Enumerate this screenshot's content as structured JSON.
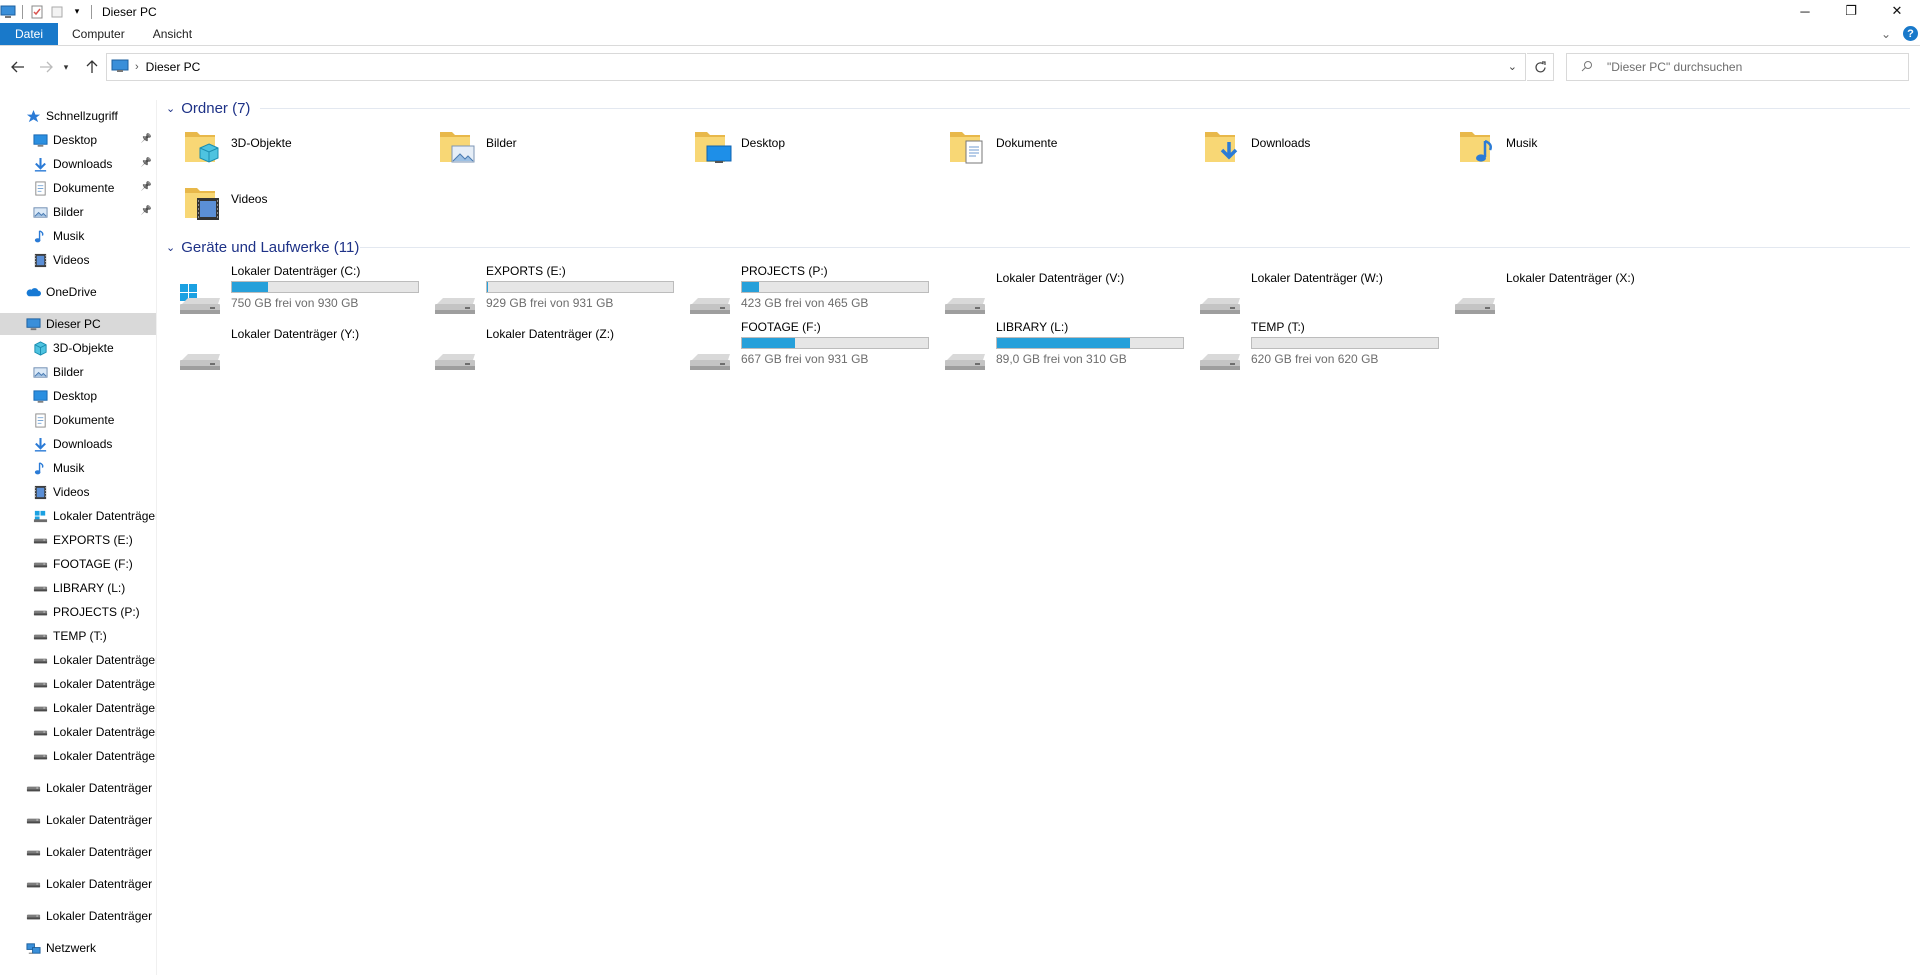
{
  "window": {
    "title": "Dieser PC",
    "controls": {
      "minimize": "─",
      "maximize": "❐",
      "close": "✕"
    }
  },
  "ribbon": {
    "tabs": [
      "Datei",
      "Computer",
      "Ansicht"
    ],
    "help_label": "?"
  },
  "address": {
    "crumbs": [
      "Dieser PC"
    ],
    "search_placeholder": "\"Dieser PC\" durchsuchen"
  },
  "sidebar": {
    "quick_access": "Schnellzugriff",
    "quick_items": [
      {
        "label": "Desktop",
        "icon": "desktop-icon",
        "pinned": true
      },
      {
        "label": "Downloads",
        "icon": "downloads-icon",
        "pinned": true
      },
      {
        "label": "Dokumente",
        "icon": "documents-icon",
        "pinned": true
      },
      {
        "label": "Bilder",
        "icon": "pictures-icon",
        "pinned": true
      },
      {
        "label": "Musik",
        "icon": "music-icon",
        "pinned": false
      },
      {
        "label": "Videos",
        "icon": "videos-icon",
        "pinned": false
      }
    ],
    "onedrive": "OneDrive",
    "this_pc": "Dieser PC",
    "pc_items": [
      {
        "label": "3D-Objekte",
        "icon": "3d-objects-icon"
      },
      {
        "label": "Bilder",
        "icon": "pictures-icon"
      },
      {
        "label": "Desktop",
        "icon": "desktop-icon"
      },
      {
        "label": "Dokumente",
        "icon": "documents-icon"
      },
      {
        "label": "Downloads",
        "icon": "downloads-icon"
      },
      {
        "label": "Musik",
        "icon": "music-icon"
      },
      {
        "label": "Videos",
        "icon": "videos-icon"
      },
      {
        "label": "Lokaler Datenträger",
        "icon": "windows-drive-icon"
      },
      {
        "label": "EXPORTS (E:)",
        "icon": "drive-icon"
      },
      {
        "label": "FOOTAGE (F:)",
        "icon": "drive-icon"
      },
      {
        "label": "LIBRARY (L:)",
        "icon": "drive-icon"
      },
      {
        "label": "PROJECTS (P:)",
        "icon": "drive-icon"
      },
      {
        "label": "TEMP (T:)",
        "icon": "drive-icon"
      },
      {
        "label": "Lokaler Datenträger",
        "icon": "drive-icon"
      },
      {
        "label": "Lokaler Datenträger",
        "icon": "drive-icon"
      },
      {
        "label": "Lokaler Datenträger",
        "icon": "drive-icon"
      },
      {
        "label": "Lokaler Datenträger",
        "icon": "drive-icon"
      },
      {
        "label": "Lokaler Datenträger",
        "icon": "drive-icon"
      }
    ],
    "extra_drives": [
      "Lokaler Datenträger (",
      "Lokaler Datenträger (",
      "Lokaler Datenträger (",
      "Lokaler Datenträger (",
      "Lokaler Datenträger ("
    ],
    "network": "Netzwerk"
  },
  "folders": {
    "header": "Ordner (7)",
    "items": [
      {
        "label": "3D-Objekte",
        "icon": "3d-objects-folder-icon"
      },
      {
        "label": "Bilder",
        "icon": "pictures-folder-icon"
      },
      {
        "label": "Desktop",
        "icon": "desktop-folder-icon"
      },
      {
        "label": "Dokumente",
        "icon": "documents-folder-icon"
      },
      {
        "label": "Downloads",
        "icon": "downloads-folder-icon"
      },
      {
        "label": "Musik",
        "icon": "music-folder-icon"
      },
      {
        "label": "Videos",
        "icon": "videos-folder-icon"
      }
    ]
  },
  "drives": {
    "header": "Geräte und Laufwerke (11)",
    "items": [
      {
        "name": "Lokaler Datenträger (C:)",
        "free_text": "750 GB frei von 930 GB",
        "used_fraction": 0.194,
        "system": true
      },
      {
        "name": "EXPORTS (E:)",
        "free_text": "929 GB frei von 931 GB",
        "used_fraction": 0.002
      },
      {
        "name": "PROJECTS (P:)",
        "free_text": "423 GB frei von 465 GB",
        "used_fraction": 0.09
      },
      {
        "name": "Lokaler Datenträger (V:)"
      },
      {
        "name": "Lokaler Datenträger (W:)"
      },
      {
        "name": "Lokaler Datenträger (X:)"
      },
      {
        "name": "Lokaler Datenträger (Y:)"
      },
      {
        "name": "Lokaler Datenträger (Z:)"
      },
      {
        "name": "FOOTAGE (F:)",
        "free_text": "667 GB frei von 931 GB",
        "used_fraction": 0.284
      },
      {
        "name": "LIBRARY (L:)",
        "free_text": "89,0 GB frei von 310 GB",
        "used_fraction": 0.713
      },
      {
        "name": "TEMP (T:)",
        "free_text": "620 GB frei von 620 GB",
        "used_fraction": 0.0
      }
    ]
  },
  "colors": {
    "accent": "#1979ca",
    "usage_bar": "#26a0da",
    "group_header": "#1e3287",
    "folder_yellow": "#f8d775"
  }
}
